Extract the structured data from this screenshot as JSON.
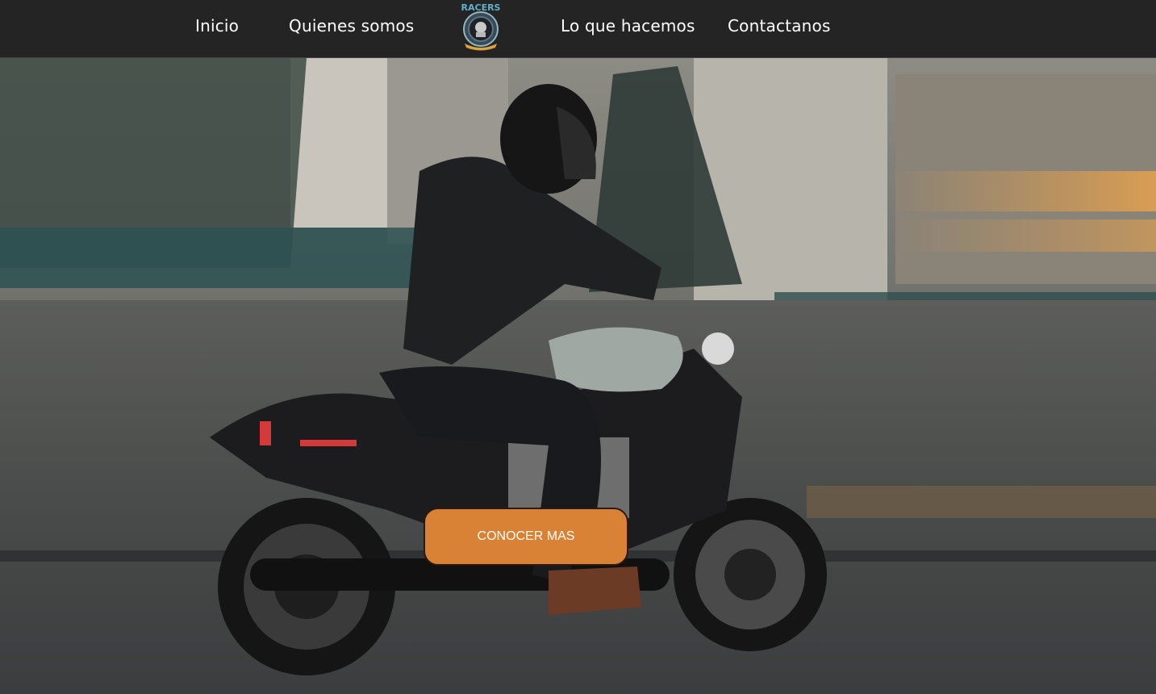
{
  "nav": {
    "items": [
      {
        "label": "Inicio"
      },
      {
        "label": "Quienes somos"
      },
      {
        "label": "Lo que hacemos"
      },
      {
        "label": "Contactanos"
      }
    ],
    "logo_text": "RACERS"
  },
  "hero": {
    "cta_label": "CONOCER MAS"
  },
  "colors": {
    "navbar_bg": "#242424",
    "cta_bg": "#d98236",
    "nav_text": "#ffffff"
  }
}
